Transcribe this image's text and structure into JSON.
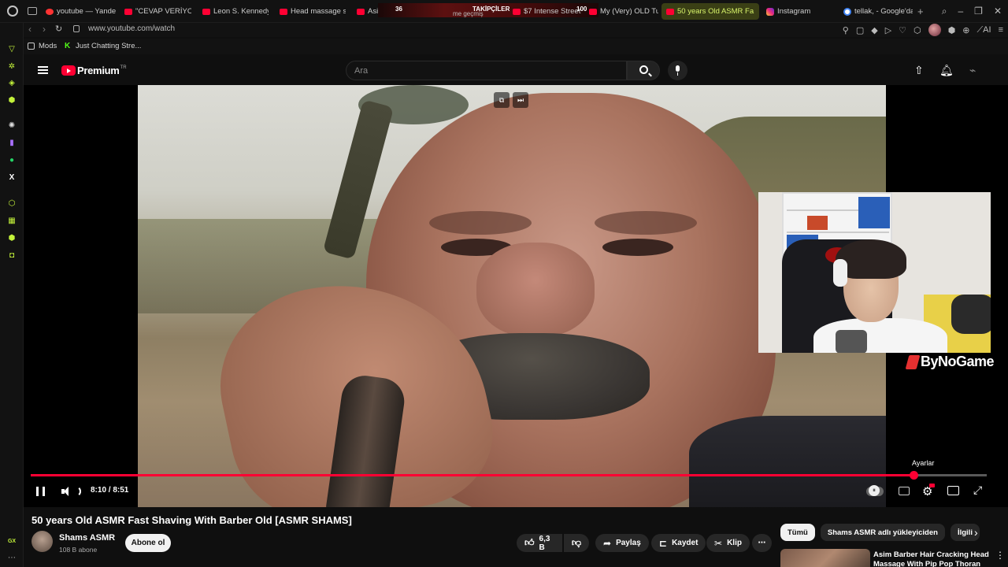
{
  "browser": {
    "tabs": [
      {
        "label": "youtube — Yande",
        "icon": "yandex-icon"
      },
      {
        "label": "\"CEVAP VERİYOR",
        "icon": "youtube-icon"
      },
      {
        "label": "Leon S. Kennedy",
        "icon": "youtube-icon"
      },
      {
        "label": "Head massage se",
        "icon": "youtube-icon"
      },
      {
        "label": "Asi",
        "icon": "youtube-icon"
      },
      {
        "label": "$7 Intense Street",
        "icon": "youtube-icon"
      },
      {
        "label": "My (Very) OLD Tu",
        "icon": "youtube-icon"
      },
      {
        "label": "50 years Old ASMR Fa",
        "icon": "youtube-icon",
        "active": true
      },
      {
        "label": "Instagram",
        "icon": "instagram-icon"
      },
      {
        "label": "tellak, - Google'da",
        "icon": "google-icon"
      }
    ],
    "stream_banner": {
      "count_left": "36",
      "label": "TAKİPÇİLER",
      "faded": "me geçmiş",
      "count_right": "100"
    },
    "url": "www.youtube.com/watch",
    "bookmarks": [
      {
        "label": "Mods"
      },
      {
        "label": "Just Chatting Stre..."
      }
    ],
    "sidebar_bottom": "GX",
    "accent": "#c3f23a"
  },
  "youtube": {
    "brand": "Premium",
    "region": "TR",
    "search_placeholder": "Ara",
    "player": {
      "current_time": "8:10",
      "duration": "8:51",
      "time_display": "8:10 / 8:51",
      "progress_fraction": 0.923,
      "settings_tooltip": "Ayarlar",
      "overlay_brand": "ByNoGame"
    },
    "video": {
      "title": "50 years Old ASMR Fast Shaving With Barber Old [ASMR SHAMS]",
      "channel": "Shams ASMR",
      "subscribers": "108 B abone",
      "subscribe_label": "Abone ol",
      "likes": "6,3 B",
      "share_label": "Paylaş",
      "save_label": "Kaydet",
      "clip_label": "Klip"
    },
    "chips": [
      "Tümü",
      "Shams ASMR adlı yükleyiciden",
      "İlgili"
    ],
    "recommendation": {
      "title": "Asim Barber Hair Cracking Head Massage With Pip Pop Thoran"
    },
    "progress_color": "#ff0033"
  }
}
